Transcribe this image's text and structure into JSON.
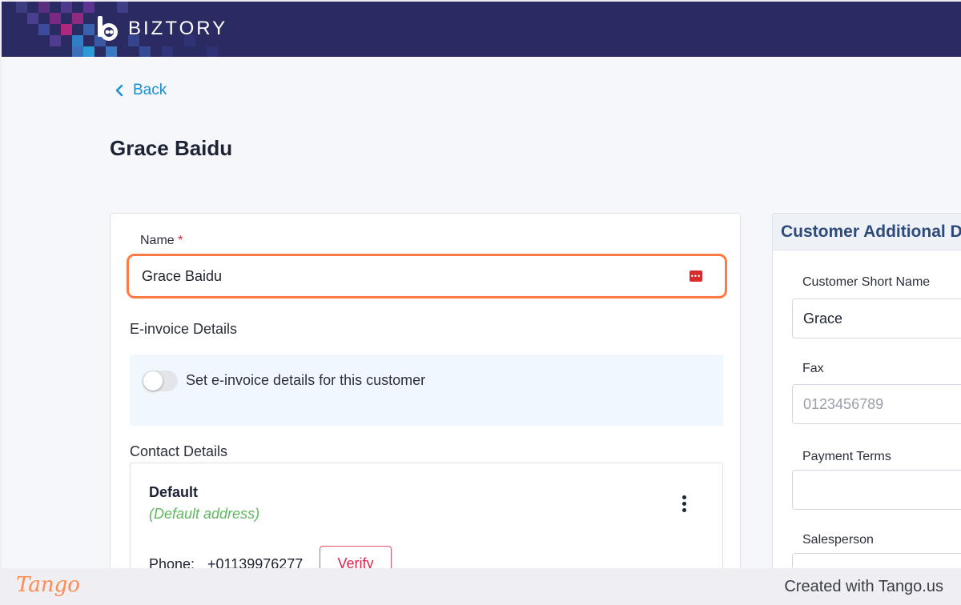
{
  "app": {
    "brand": "BIZTORY"
  },
  "nav": {
    "back_label": "Back"
  },
  "page": {
    "title": "Grace Baidu"
  },
  "form": {
    "name_label": "Name",
    "name_required_mark": "*",
    "name_value": "Grace Baidu",
    "einvoice_title": "E-invoice Details",
    "einvoice_toggle_label": "Set e-invoice details for this customer",
    "einvoice_toggle_on": false,
    "contact_title": "Contact Details",
    "contact": {
      "name": "Default",
      "subtitle": "(Default address)",
      "phone_label": "Phone:",
      "phone_value": "+01139976277",
      "verify_label": "Verify"
    }
  },
  "side_panel": {
    "title": "Customer Additional De",
    "fields": [
      {
        "label": "Customer Short Name",
        "value": "Grace",
        "placeholder": ""
      },
      {
        "label": "Fax",
        "value": "",
        "placeholder": "0123456789"
      },
      {
        "label": "Payment Terms",
        "value": "",
        "placeholder": ""
      },
      {
        "label": "Salesperson",
        "value": "",
        "placeholder": ""
      }
    ]
  },
  "footer": {
    "logo": "Tango",
    "credit": "Created with Tango.us"
  },
  "colors": {
    "topbar": "#2a2b62",
    "accent_link": "#1a8fd1",
    "highlight_border": "#ff7a45",
    "verify_red": "#e0274a",
    "default_green": "#5cb85c"
  },
  "icons": {
    "back": "chevron-left-icon",
    "password_manager": "password-manager-icon",
    "more": "kebab-icon"
  }
}
